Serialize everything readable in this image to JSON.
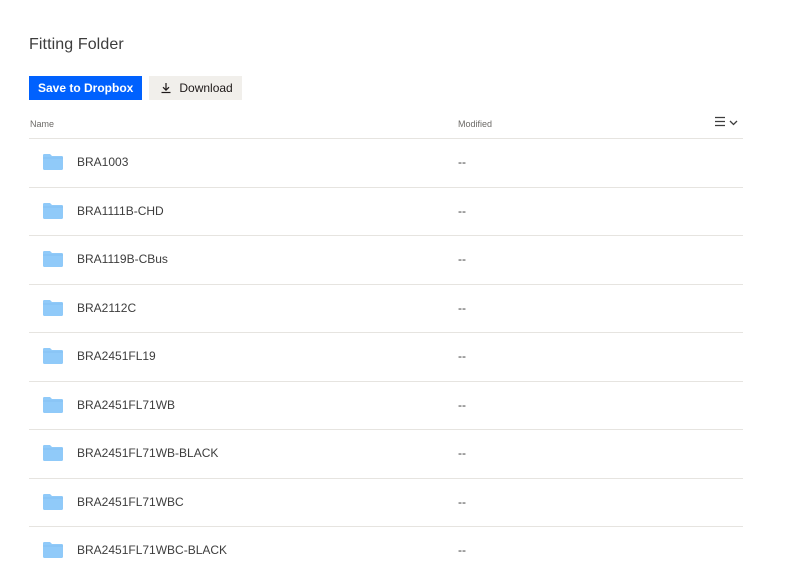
{
  "folder": {
    "title": "Fitting Folder"
  },
  "toolbar": {
    "save_label": "Save to Dropbox",
    "download_label": "Download"
  },
  "table": {
    "columns": {
      "name": "Name",
      "modified": "Modified"
    },
    "rows": [
      {
        "name": "BRA1003",
        "modified": "--"
      },
      {
        "name": "BRA1111B-CHD",
        "modified": "--"
      },
      {
        "name": "BRA1119B-CBus",
        "modified": "--"
      },
      {
        "name": "BRA2112C",
        "modified": "--"
      },
      {
        "name": "BRA2451FL19",
        "modified": "--"
      },
      {
        "name": "BRA2451FL71WB",
        "modified": "--"
      },
      {
        "name": "BRA2451FL71WB-BLACK",
        "modified": "--"
      },
      {
        "name": "BRA2451FL71WBC",
        "modified": "--"
      },
      {
        "name": "BRA2451FL71WBC-BLACK",
        "modified": "--"
      }
    ]
  },
  "icons": {
    "folder": "folder-icon",
    "download": "download-icon",
    "view_toggle": "list-view-icon",
    "chevron": "chevron-down-icon"
  },
  "colors": {
    "primary": "#0061fe",
    "secondary_bg": "#f1efeb",
    "folder": "#90caf9",
    "divider": "#e6e4e0"
  }
}
